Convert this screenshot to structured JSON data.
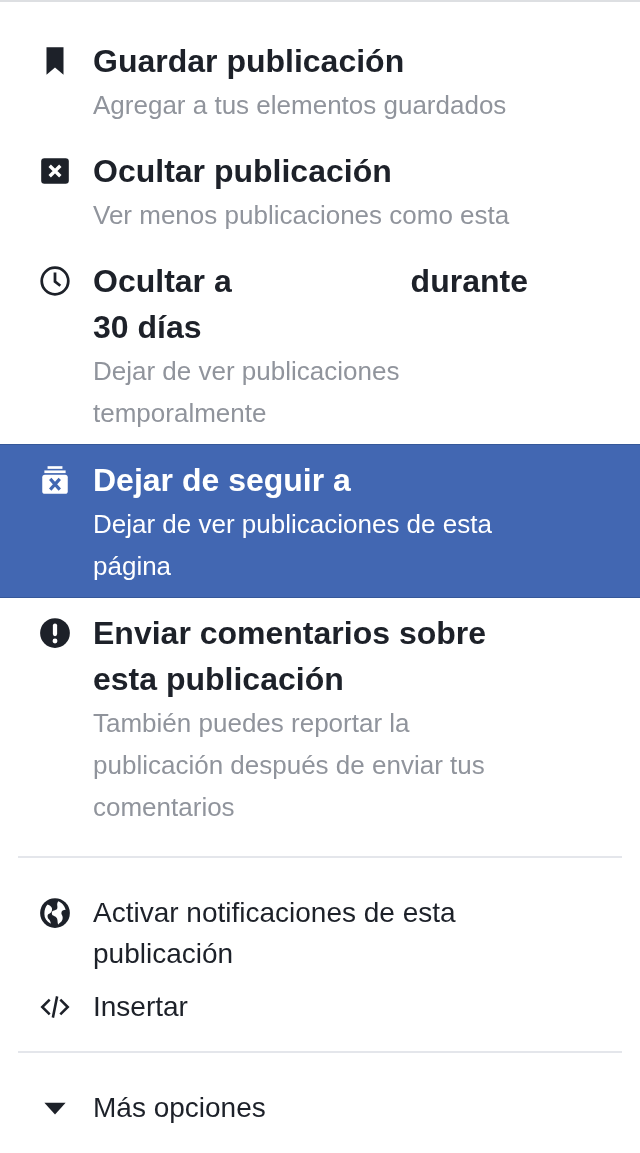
{
  "sections": [
    {
      "items": [
        {
          "kind": "rich",
          "selected": false,
          "title_parts": [
            "Guardar publicación"
          ],
          "subtitle": "Agregar a tus elementos guardados"
        },
        {
          "kind": "rich",
          "selected": false,
          "title_parts": [
            "Ocultar publicación"
          ],
          "subtitle": "Ver menos publicaciones como esta"
        },
        {
          "kind": "rich",
          "selected": false,
          "title_parts": [
            "Ocultar a",
            "durante",
            "30 días"
          ],
          "subtitle": "Dejar de ver publicaciones temporalmente"
        },
        {
          "kind": "rich",
          "selected": true,
          "title_parts": [
            "Dejar de seguir a"
          ],
          "subtitle": "Dejar de ver publicaciones de esta página"
        },
        {
          "kind": "rich",
          "selected": false,
          "title_parts": [
            "Enviar comentarios sobre esta publicación"
          ],
          "subtitle": "También puedes reportar la publicación después de enviar tus comentarios"
        }
      ]
    },
    {
      "items": [
        {
          "kind": "simple",
          "label": "Activar notificaciones de esta publicación"
        },
        {
          "kind": "simple",
          "label": "Insertar"
        }
      ]
    },
    {
      "items": [
        {
          "kind": "simple",
          "label": "Más opciones"
        }
      ]
    }
  ]
}
